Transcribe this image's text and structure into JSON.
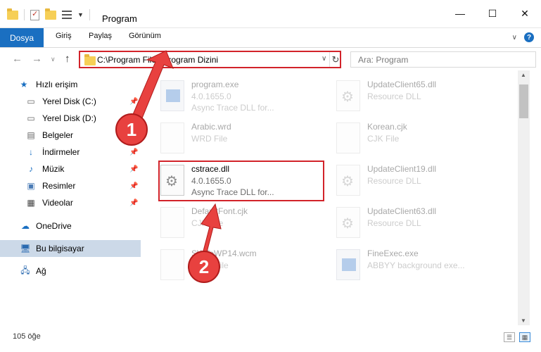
{
  "window": {
    "title": "Program",
    "controls": {
      "minimize": "—",
      "maximize": "☐",
      "close": "✕"
    }
  },
  "ribbon": {
    "tabs": [
      "Dosya",
      "Giriş",
      "Paylaş",
      "Görünüm"
    ],
    "chevron": "∨",
    "help": "?"
  },
  "navigation": {
    "back": "←",
    "forward": "→",
    "dropdown": "∨",
    "up": "↑"
  },
  "address": {
    "path": "C:\\Program Files\\Program Dizini",
    "dropdown": "∨",
    "refresh": "↻"
  },
  "search": {
    "placeholder": "Ara: Program"
  },
  "sidebar": {
    "items": [
      {
        "label": "Hızlı erişim",
        "icon": "star-icon",
        "pinned": false
      },
      {
        "label": "Yerel Disk (C:)",
        "icon": "drive-icon",
        "pinned": true
      },
      {
        "label": "Yerel Disk (D:)",
        "icon": "drive-icon",
        "pinned": false
      },
      {
        "label": "Belgeler",
        "icon": "document-icon",
        "pinned": true
      },
      {
        "label": "İndirmeler",
        "icon": "download-icon",
        "pinned": true
      },
      {
        "label": "Müzik",
        "icon": "music-icon",
        "pinned": true
      },
      {
        "label": "Resimler",
        "icon": "pictures-icon",
        "pinned": true
      },
      {
        "label": "Videolar",
        "icon": "video-icon",
        "pinned": true
      },
      {
        "label": "OneDrive",
        "icon": "cloud-icon",
        "pinned": false
      },
      {
        "label": "Bu bilgisayar",
        "icon": "computer-icon",
        "pinned": false,
        "selected": true
      },
      {
        "label": "Ağ",
        "icon": "network-icon",
        "pinned": false
      }
    ],
    "pin_glyph": "📌"
  },
  "files": {
    "left": [
      {
        "name": "program.exe",
        "line2": "4.0.1655.0",
        "line3": "Async Trace DLL for...",
        "icon": "exe-icon",
        "faded": true
      },
      {
        "name": "Arabic.wrd",
        "line2": "WRD File",
        "line3": "",
        "icon": "file-icon",
        "faded": true
      },
      {
        "name": "cstrace.dll",
        "line2": "4.0.1655.0",
        "line3": "Async Trace DLL for...",
        "icon": "dll-icon",
        "faded": false,
        "highlighted": true
      },
      {
        "name": "DefaultFont.cjk",
        "line2": "CJK File",
        "line3": "",
        "icon": "file-icon",
        "faded": true
      },
      {
        "name": "SWToWP14.wcm",
        "line2": "WCM File",
        "line3": "",
        "icon": "file-icon",
        "faded": true
      }
    ],
    "right": [
      {
        "name": "UpdateClient65.dll",
        "line2": "Resource DLL",
        "icon": "dll-icon",
        "faded": true
      },
      {
        "name": "Korean.cjk",
        "line2": "CJK File",
        "icon": "file-icon",
        "faded": true
      },
      {
        "name": "UpdateClient19.dll",
        "line2": "Resource DLL",
        "icon": "dll-icon",
        "faded": true
      },
      {
        "name": "UpdateClient63.dll",
        "line2": "Resource DLL",
        "icon": "dll-icon",
        "faded": true
      },
      {
        "name": "FineExec.exe",
        "line2": "ABBYY background exe...",
        "icon": "exe-icon",
        "faded": true
      }
    ]
  },
  "annotations": {
    "step1": "1",
    "step2": "2",
    "accent": "#d2232a"
  },
  "status": {
    "count": "105 öğe"
  }
}
